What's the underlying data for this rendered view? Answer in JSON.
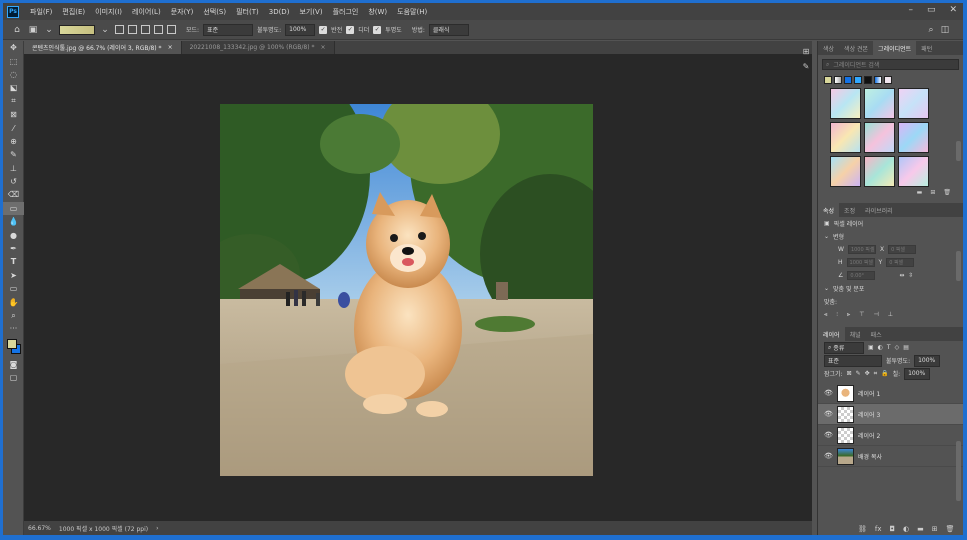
{
  "menu": [
    "파일(F)",
    "편집(E)",
    "이미지(I)",
    "레이어(L)",
    "문자(Y)",
    "선택(S)",
    "필터(T)",
    "3D(D)",
    "보기(V)",
    "플러그인",
    "창(W)",
    "도움말(H)"
  ],
  "window_controls": [
    "–",
    "▭",
    "✕"
  ],
  "options": {
    "mode_label": "모드:",
    "mode_value": "표준",
    "opacity_label": "불투명도:",
    "opacity_value": "100%",
    "reverse_label": "반전",
    "dither_label": "디더",
    "transparency_label": "투명도",
    "method_label": "방법:",
    "method_value": "클래식"
  },
  "tabs": [
    "콘텐츠인식툴.jpg @ 66.7% (레이어 3, RGB/8) *",
    "20221008_133342.jpg @ 100% (RGB/8) *"
  ],
  "status": {
    "zoom": "66.67%",
    "size": "1000 픽셀 x 1000 픽셀 (72 ppi)"
  },
  "gradient_panel": {
    "tabs": [
      "색상",
      "색상 견본",
      "그레이디언트",
      "패턴"
    ],
    "search_placeholder": "그레이디언트 검색"
  },
  "properties_panel": {
    "tabs": [
      "속성",
      "조정",
      "라이브러리"
    ],
    "layer_type": "픽셀 레이어",
    "transform_label": "변형",
    "align_label": "맞춤 및 분포",
    "align_sublabel": "맞춤:",
    "fields": [
      "1000 픽셀",
      "0 픽셀",
      "1000 픽셀",
      "0 픽셀",
      "0.00°"
    ],
    "w_label": "W",
    "h_label": "H",
    "x_label": "X",
    "y_label": "Y"
  },
  "layers_panel": {
    "tabs": [
      "레이어",
      "채널",
      "패스"
    ],
    "kind_value": "종류",
    "blend_value": "표준",
    "opacity_label": "불투명도:",
    "opacity_value": "100%",
    "lock_label": "잠그기:",
    "fill_label": "칠:",
    "fill_value": "100%",
    "layers": [
      {
        "name": "레이어 1",
        "selected": false,
        "thumb": "dog"
      },
      {
        "name": "레이어 3",
        "selected": true,
        "thumb": "transparent"
      },
      {
        "name": "레이어 2",
        "selected": false,
        "thumb": "transparent"
      },
      {
        "name": "배경 복사",
        "selected": false,
        "thumb": "photo"
      }
    ]
  },
  "colors": {
    "background": "#535353",
    "canvas_bg": "#282828",
    "accent_blue": "#1473e6",
    "foreground_swatch": "#d8d79a"
  }
}
